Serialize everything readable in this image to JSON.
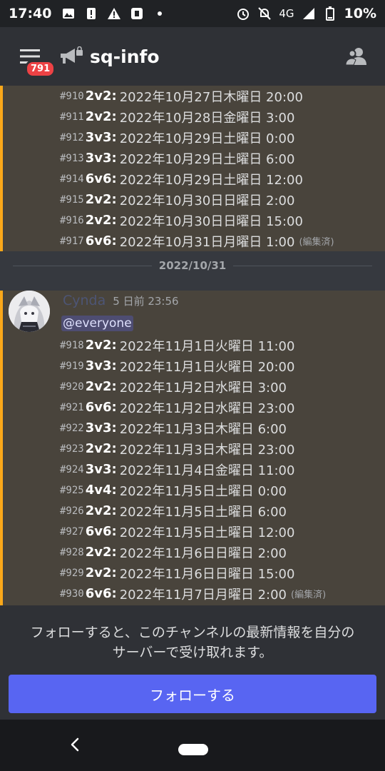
{
  "status_bar": {
    "time": "17:40",
    "network": "4G",
    "battery": "10%"
  },
  "header": {
    "badge": "791",
    "channel": "sq-info",
    "menu_icon": "hamburger-menu-icon",
    "channel_icon": "megaphone-icon",
    "members_icon": "members-icon"
  },
  "messages": {
    "block1": [
      {
        "num": "#910",
        "mode": "2v2:",
        "text": "2022年10月27日木曜日 20:00",
        "edited": ""
      },
      {
        "num": "#911",
        "mode": "2v2:",
        "text": "2022年10月28日金曜日 3:00",
        "edited": ""
      },
      {
        "num": "#912",
        "mode": "3v3:",
        "text": "2022年10月29日土曜日 0:00",
        "edited": ""
      },
      {
        "num": "#913",
        "mode": "3v3:",
        "text": "2022年10月29日土曜日 6:00",
        "edited": ""
      },
      {
        "num": "#914",
        "mode": "6v6:",
        "text": "2022年10月29日土曜日 12:00",
        "edited": ""
      },
      {
        "num": "#915",
        "mode": "2v2:",
        "text": "2022年10月30日日曜日 2:00",
        "edited": ""
      },
      {
        "num": "#916",
        "mode": "2v2:",
        "text": "2022年10月30日日曜日 15:00",
        "edited": ""
      },
      {
        "num": "#917",
        "mode": "6v6:",
        "text": "2022年10月31日月曜日 1:00",
        "edited": "(編集済)"
      }
    ],
    "date_divider": "2022/10/31",
    "author": "Cynda",
    "timestamp": "5 日前 23:56",
    "mention": "@everyone",
    "block2": [
      {
        "num": "#918",
        "mode": "2v2:",
        "text": "2022年11月1日火曜日 11:00",
        "edited": ""
      },
      {
        "num": "#919",
        "mode": "3v3:",
        "text": "2022年11月1日火曜日 20:00",
        "edited": ""
      },
      {
        "num": "#920",
        "mode": "2v2:",
        "text": "2022年11月2日水曜日 3:00",
        "edited": ""
      },
      {
        "num": "#921",
        "mode": "6v6:",
        "text": "2022年11月2日水曜日 23:00",
        "edited": ""
      },
      {
        "num": "#922",
        "mode": "3v3:",
        "text": "2022年11月3日木曜日 6:00",
        "edited": ""
      },
      {
        "num": "#923",
        "mode": "2v2:",
        "text": "2022年11月3日木曜日 23:00",
        "edited": ""
      },
      {
        "num": "#924",
        "mode": "3v3:",
        "text": "2022年11月4日金曜日 11:00",
        "edited": ""
      },
      {
        "num": "#925",
        "mode": "4v4:",
        "text": "2022年11月5日土曜日 0:00",
        "edited": ""
      },
      {
        "num": "#926",
        "mode": "2v2:",
        "text": "2022年11月5日土曜日 6:00",
        "edited": ""
      },
      {
        "num": "#927",
        "mode": "6v6:",
        "text": "2022年11月5日土曜日 12:00",
        "edited": ""
      },
      {
        "num": "#928",
        "mode": "2v2:",
        "text": "2022年11月6日日曜日 2:00",
        "edited": ""
      },
      {
        "num": "#929",
        "mode": "2v2:",
        "text": "2022年11月6日日曜日 15:00",
        "edited": ""
      },
      {
        "num": "#930",
        "mode": "6v6:",
        "text": "2022年11月7日月曜日 2:00",
        "edited": "(編集済)"
      }
    ]
  },
  "follow": {
    "text_line1": "フォローすると、このチャンネルの最新情報を自分の",
    "text_line2": "サーバーで受け取れます。",
    "button": "フォローする"
  },
  "colors": {
    "accent": "#5865f2",
    "mention_highlight": "#faa81a",
    "badge": "#ed4245"
  }
}
